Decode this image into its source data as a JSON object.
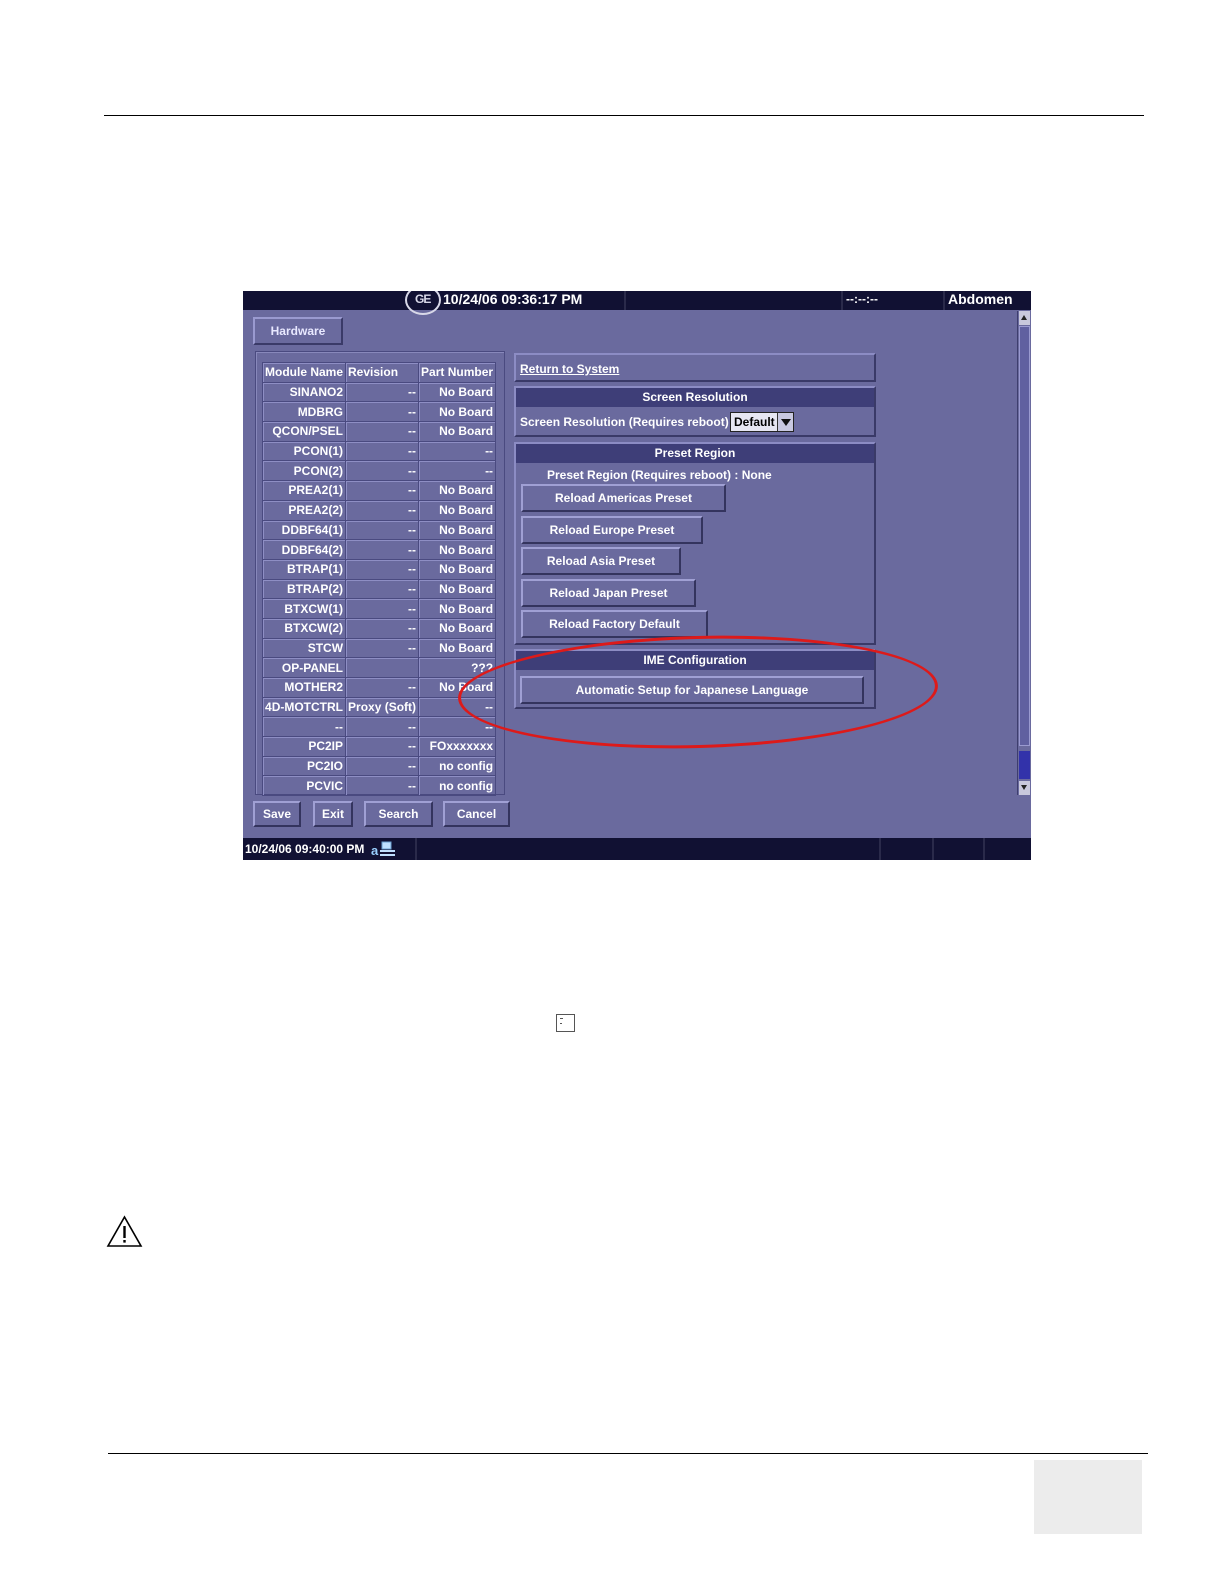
{
  "screen": {
    "top_bar": {
      "datetime": "10/24/06 09:36:17 PM",
      "indicator": "--:--:--",
      "preset": "Abdomen",
      "logo": "ge-logo"
    },
    "tab": {
      "label": "Hardware"
    },
    "table": {
      "headers": [
        "Module Name",
        "Revision",
        "Part Number"
      ],
      "rows": [
        [
          "SINANO2",
          "--",
          "No Board"
        ],
        [
          "MDBRG",
          "--",
          "No Board"
        ],
        [
          "QCON/PSEL",
          "--",
          "No Board"
        ],
        [
          "PCON(1)",
          "--",
          "--"
        ],
        [
          "PCON(2)",
          "--",
          "--"
        ],
        [
          "PREA2(1)",
          "--",
          "No Board"
        ],
        [
          "PREA2(2)",
          "--",
          "No Board"
        ],
        [
          "DDBF64(1)",
          "--",
          "No Board"
        ],
        [
          "DDBF64(2)",
          "--",
          "No Board"
        ],
        [
          "BTRAP(1)",
          "--",
          "No Board"
        ],
        [
          "BTRAP(2)",
          "--",
          "No Board"
        ],
        [
          "BTXCW(1)",
          "--",
          "No Board"
        ],
        [
          "BTXCW(2)",
          "--",
          "No Board"
        ],
        [
          "STCW",
          "--",
          "No Board"
        ],
        [
          "OP-PANEL",
          "",
          "???"
        ],
        [
          "MOTHER2",
          "--",
          "No Board"
        ],
        [
          "4D-MOTCTRL",
          "Proxy (Soft)",
          "--"
        ],
        [
          "--",
          "--",
          "--"
        ],
        [
          "PC2IP",
          "--",
          "FOxxxxxxx"
        ],
        [
          "PC2IO",
          "--",
          "no config"
        ],
        [
          "PCVIC",
          "--",
          "no config"
        ]
      ]
    },
    "buttons": {
      "save": "Save",
      "exit": "Exit",
      "search": "Search",
      "cancel": "Cancel"
    },
    "return_link": "Return to System",
    "screen_resolution": {
      "title": "Screen Resolution",
      "label": "Screen Resolution (Requires reboot)",
      "value": "Default"
    },
    "preset_region": {
      "title": "Preset Region",
      "label": "Preset Region (Requires reboot) : None",
      "buttons": [
        "Reload Americas Preset",
        "Reload Europe Preset",
        "Reload Asia Preset",
        "Reload Japan Preset",
        "Reload Factory Default"
      ]
    },
    "ime": {
      "title": "IME Configuration",
      "button": "Automatic Setup for Japanese Language"
    },
    "status_bar": {
      "datetime": "10/24/06 09:40:00 PM"
    },
    "colors": {
      "background": "#6a6a9e",
      "bar": "#111133",
      "header": "#3e3e78",
      "highlight_ellipse": "#dd1a1a"
    }
  }
}
